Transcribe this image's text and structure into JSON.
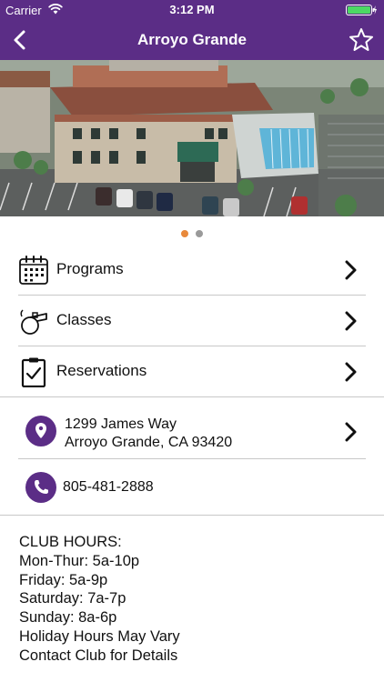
{
  "status_bar": {
    "carrier": "Carrier",
    "time": "3:12 PM"
  },
  "nav": {
    "title": "Arroyo Grande",
    "back_icon": "chevron-left-icon",
    "favorite_icon": "star-outline-icon"
  },
  "carousel": {
    "active_index": 0,
    "dot_count": 2,
    "active_color": "#e8893b",
    "inactive_color": "#9a9a9a"
  },
  "menu": [
    {
      "label": "Programs",
      "icon": "calendar-icon"
    },
    {
      "label": "Classes",
      "icon": "whistle-icon"
    },
    {
      "label": "Reservations",
      "icon": "clipboard-check-icon"
    }
  ],
  "location": {
    "address_line1": "1299 James Way",
    "address_line2": "Arroyo Grande, CA 93420",
    "icon": "map-pin-icon"
  },
  "contact": {
    "phone": "805-481-2888",
    "icon": "phone-icon"
  },
  "hours": {
    "heading": "CLUB HOURS:",
    "lines": [
      "Mon-Thur: 5a-10p",
      "Friday: 5a-9p",
      "Saturday: 7a-7p",
      "Sunday: 8a-6p",
      "Holiday Hours May Vary",
      "Contact Club for Details"
    ]
  },
  "colors": {
    "brand": "#5b2d86",
    "divider": "#c8c8c8",
    "battery": "#4cd964"
  }
}
